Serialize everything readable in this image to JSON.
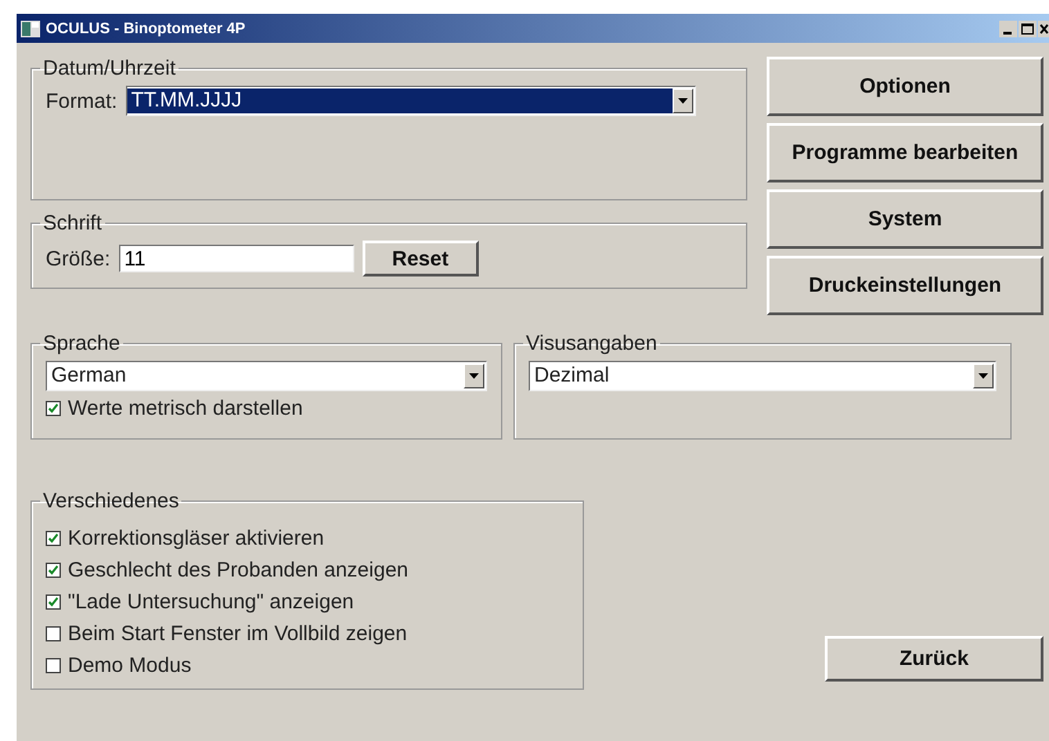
{
  "window": {
    "title": "OCULUS - Binoptometer 4P"
  },
  "datum": {
    "legend": "Datum/Uhrzeit",
    "label": "Format:",
    "dropdown": {
      "value": "TT.MM.JJJJ",
      "highlighted": true
    }
  },
  "schrift": {
    "legend": "Schrift",
    "label": "Größe:",
    "value": "11",
    "button": "Reset"
  },
  "sprache": {
    "legend": "Sprache",
    "dropdown": {
      "value": "German",
      "highlighted": false
    },
    "checkbox": {
      "label": "Werte metrisch darstellen",
      "checked": true
    }
  },
  "visus": {
    "legend": "Visusangaben",
    "dropdown": {
      "value": "Dezimal",
      "highlighted": false
    }
  },
  "verschiedenes": {
    "legend": "Verschiedenes",
    "checkboxes": [
      {
        "label": "Korrektionsgläser aktivieren",
        "checked": true
      },
      {
        "label": "Geschlecht des Probanden anzeigen",
        "checked": true
      },
      {
        "label": "\"Lade Untersuchung\" anzeigen",
        "checked": true
      },
      {
        "label": "Beim Start Fenster im Vollbild zeigen",
        "checked": false
      },
      {
        "label": "Demo Modus",
        "checked": false
      }
    ]
  },
  "side_buttons": [
    "Optionen",
    "Programme bearbeiten",
    "System",
    "Druckeinstellungen"
  ],
  "back_button": "Zurück"
}
